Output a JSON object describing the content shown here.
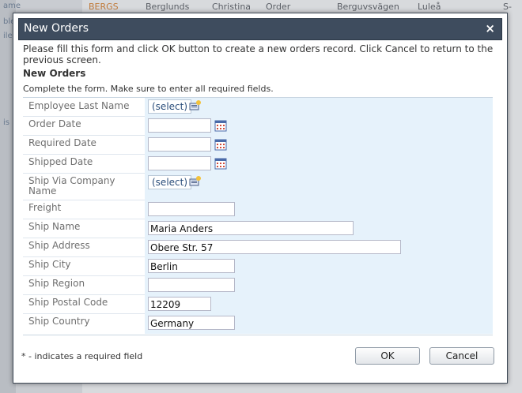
{
  "background": {
    "cells": [
      "BERGS",
      "Berglunds",
      "Christina",
      "Order",
      "Berguvsvägen",
      "Luleå",
      "S-"
    ],
    "left_fragments": [
      "ame",
      "ble",
      "ile",
      "is"
    ]
  },
  "dialog": {
    "title": "New Orders",
    "close_glyph": "×",
    "description": "Please fill this form and click OK button to create a new orders record. Click Cancel to return to the previous screen.",
    "form_title": "New Orders",
    "instructions": "Complete the form. Make sure to enter all required fields.",
    "fields": [
      {
        "label": "Employee Last Name",
        "type": "lookup",
        "value": "(select)"
      },
      {
        "label": "Order Date",
        "type": "date",
        "value": ""
      },
      {
        "label": "Required Date",
        "type": "date",
        "value": ""
      },
      {
        "label": "Shipped Date",
        "type": "date",
        "value": ""
      },
      {
        "label": "Ship Via Company Name",
        "type": "lookup",
        "value": "(select)"
      },
      {
        "label": "Freight",
        "type": "text",
        "value": ""
      },
      {
        "label": "Ship Name",
        "type": "text",
        "value": "Maria Anders"
      },
      {
        "label": "Ship Address",
        "type": "text",
        "value": "Obere Str. 57"
      },
      {
        "label": "Ship City",
        "type": "text",
        "value": "Berlin"
      },
      {
        "label": "Ship Region",
        "type": "text",
        "value": ""
      },
      {
        "label": "Ship Postal Code",
        "type": "text",
        "value": "12209"
      },
      {
        "label": "Ship Country",
        "type": "text",
        "value": "Germany"
      }
    ],
    "required_note": "* - indicates a required field",
    "ok_label": "OK",
    "cancel_label": "Cancel"
  }
}
